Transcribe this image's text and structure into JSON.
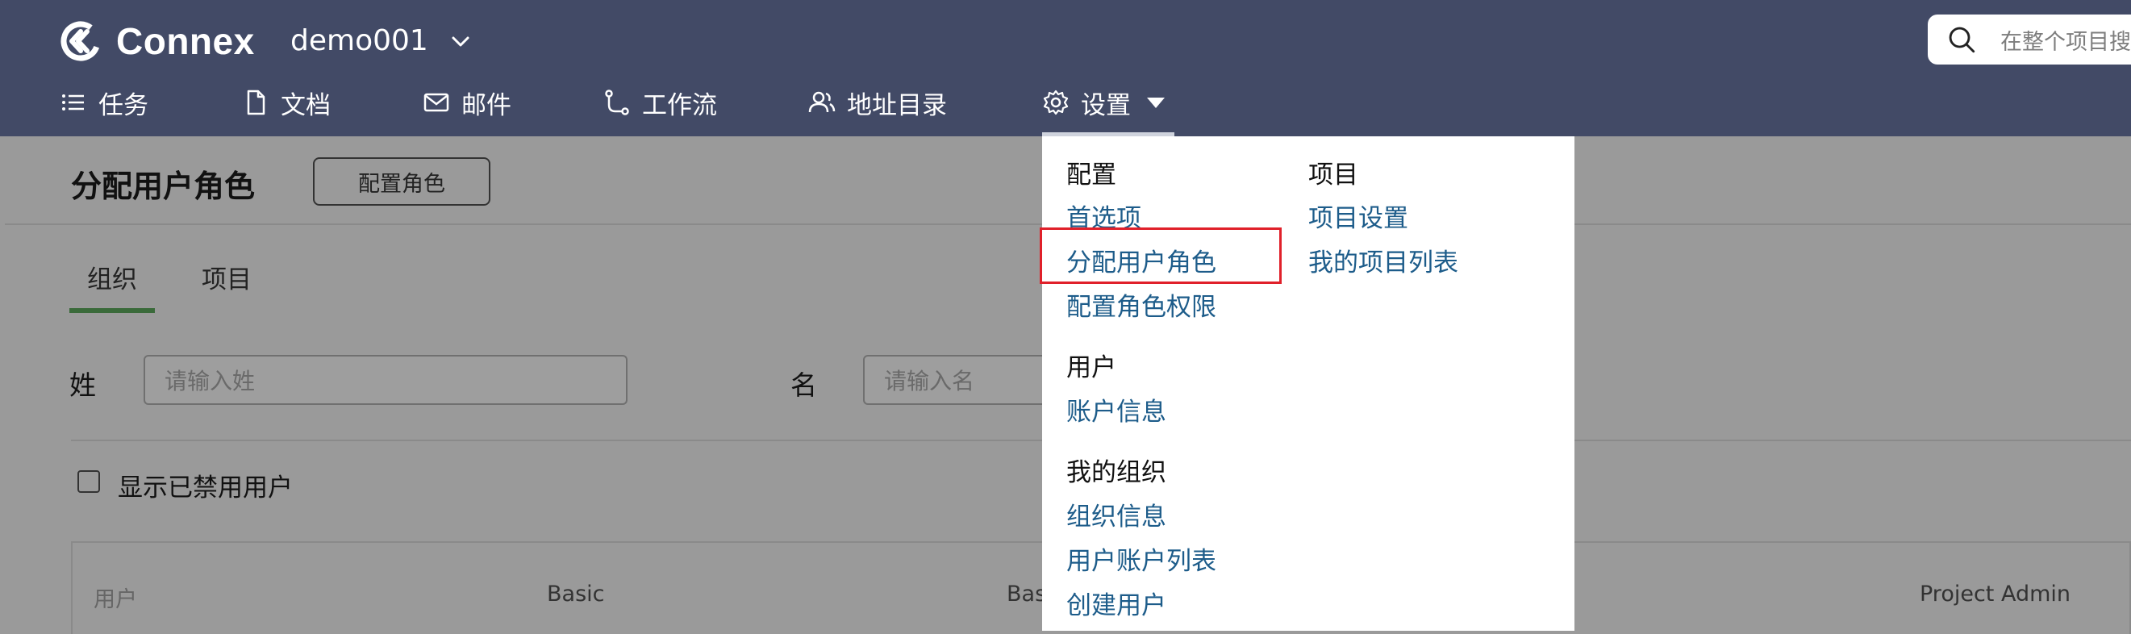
{
  "header": {
    "brand": "Connex",
    "workspace": "demo001",
    "search_placeholder": "在整个项目搜"
  },
  "nav": {
    "tasks": "任务",
    "docs": "文档",
    "mail": "邮件",
    "workflow": "工作流",
    "directory": "地址目录",
    "settings": "设置"
  },
  "page": {
    "title": "分配用户角色",
    "config_button": "配置角色",
    "tabs": [
      "组织",
      "项目"
    ],
    "last_name_label": "姓",
    "last_name_placeholder": "请输入姓",
    "first_name_label": "名",
    "first_name_placeholder": "请输入名",
    "show_disabled_label": "显示已禁用用户",
    "table_headers": [
      "用户",
      "Basic",
      "Bas",
      "Project Admin"
    ]
  },
  "dropdown": {
    "col1": {
      "config_heading": "配置",
      "config_links": [
        "首选项",
        "分配用户角色",
        "配置角色权限"
      ],
      "user_heading": "用户",
      "user_links": [
        "账户信息"
      ],
      "org_heading": "我的组织",
      "org_links": [
        "组织信息",
        "用户账户列表",
        "创建用户"
      ]
    },
    "col2": {
      "project_heading": "项目",
      "project_links": [
        "项目设置",
        "我的项目列表"
      ]
    }
  },
  "colors": {
    "header_bg": "#424a66",
    "link": "#1d5c8a",
    "highlight": "#e0202a",
    "tab_active": "#3a6a3a"
  }
}
